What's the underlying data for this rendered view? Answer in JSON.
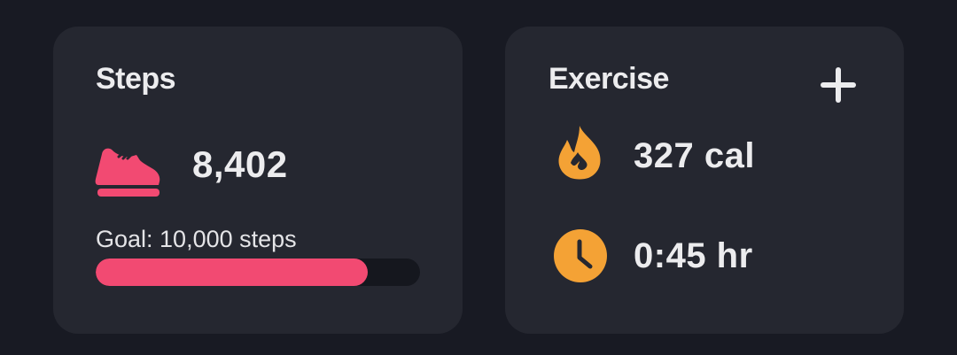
{
  "steps": {
    "title": "Steps",
    "value": "8,402",
    "goal_text": "Goal: 10,000 steps",
    "progress": 0.84,
    "icon": "shoe-icon",
    "accent": "#f24a72"
  },
  "exercise": {
    "title": "Exercise",
    "add_icon": "plus-icon",
    "calories": "327 cal",
    "calories_icon": "flame-icon",
    "duration": "0:45 hr",
    "duration_icon": "clock-icon",
    "accent": "#f4a235"
  }
}
